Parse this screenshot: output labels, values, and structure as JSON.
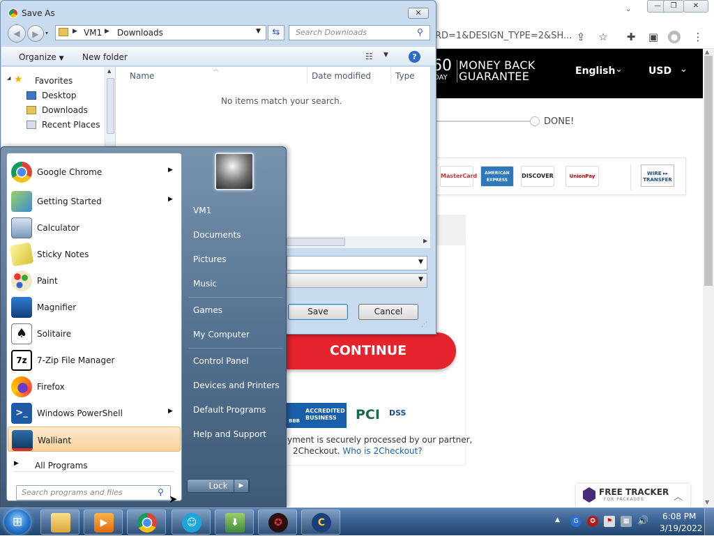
{
  "browser": {
    "url_fragment": "RD=1&DESIGN_TYPE=2&SH...",
    "guarantee_num": "60",
    "guarantee_day": "DAY",
    "guarantee_text_1": "MONEY BACK",
    "guarantee_text_2": "GUARANTEE",
    "language": "English",
    "currency": "USD",
    "done_label": "DONE!",
    "cards": [
      "MasterCard",
      "AMERICAN EXPRESS",
      "DISCOVER",
      "UnionPay"
    ],
    "wire_label_1": "WIRE ▸▸",
    "wire_label_2": "TRANSFER",
    "continue_label": "CONTINUE",
    "bbb_line1": "ACCREDITED",
    "bbb_line2": "BUSINESS",
    "bbb_logo": "BBB",
    "pci_text": "PCI",
    "pci_dss": "DSS",
    "secure_line1": "yment is securely processed by our partner,",
    "secure_line2": "2Checkout.",
    "secure_link": "Who is 2Checkout?",
    "tracker_title": "FREE TRACKER",
    "tracker_sub": "FOR PACKAGES"
  },
  "dialog": {
    "title": "Save As",
    "path": [
      "VM1",
      "Downloads"
    ],
    "search_placeholder": "Search Downloads",
    "toolbar": {
      "organize": "Organize",
      "new_folder": "New folder"
    },
    "nav": [
      "Favorites",
      "Desktop",
      "Downloads",
      "Recent Places"
    ],
    "columns": [
      "Name",
      "Date modified",
      "Type"
    ],
    "empty_message": "No items match your search.",
    "save_label": "Save",
    "cancel_label": "Cancel"
  },
  "start_menu": {
    "programs": [
      {
        "label": "Google Chrome",
        "icon": "chrome-icon",
        "arrow": true
      },
      {
        "label": "Getting Started",
        "icon": "getting-started-icon",
        "arrow": true
      },
      {
        "label": "Calculator",
        "icon": "calculator-icon",
        "arrow": false
      },
      {
        "label": "Sticky Notes",
        "icon": "sticky-notes-icon",
        "arrow": false
      },
      {
        "label": "Paint",
        "icon": "paint-icon",
        "arrow": false
      },
      {
        "label": "Magnifier",
        "icon": "magnifier-icon",
        "arrow": false
      },
      {
        "label": "Solitaire",
        "icon": "solitaire-icon",
        "arrow": false
      },
      {
        "label": "7-Zip File Manager",
        "icon": "7zip-icon",
        "arrow": false
      },
      {
        "label": "Firefox",
        "icon": "firefox-icon",
        "arrow": false
      },
      {
        "label": "Windows PowerShell",
        "icon": "powershell-icon",
        "arrow": true
      },
      {
        "label": "Walliant",
        "icon": "walliant-icon",
        "arrow": false
      }
    ],
    "all_programs": "All Programs",
    "search_placeholder": "Search programs and files",
    "right_links": [
      "VM1",
      "Documents",
      "Pictures",
      "Music",
      "Games",
      "My Computer",
      "Control Panel",
      "Devices and Printers",
      "Default Programs",
      "Help and Support"
    ],
    "lock_label": "Lock"
  },
  "taskbar": {
    "clock_time": "6:08 PM",
    "clock_date": "3/19/2022",
    "apps": [
      "explorer-icon",
      "media-player-icon",
      "chrome-icon",
      "accessibility-icon",
      "download-manager-icon",
      "red-app-icon",
      "ccleaner-icon"
    ]
  },
  "colors": {
    "continue": "#e5232d",
    "accent": "#2e6bc7",
    "header": "#000000"
  }
}
